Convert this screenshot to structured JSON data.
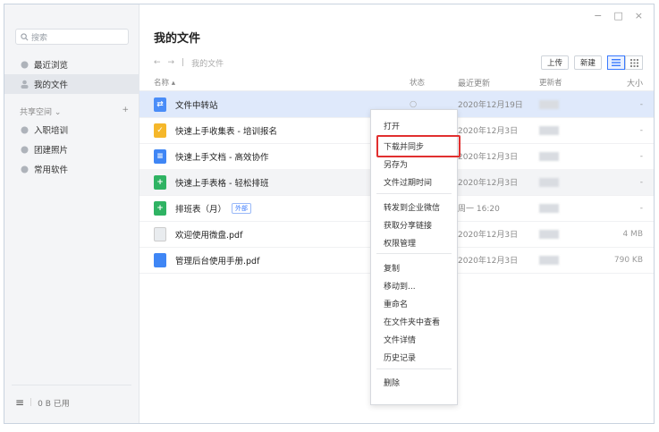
{
  "sidebar": {
    "search_placeholder": "搜索",
    "nav": [
      {
        "label": "最近浏览",
        "icon": "clock-icon"
      },
      {
        "label": "我的文件",
        "icon": "user-icon"
      }
    ],
    "section_title": "共享空间 ⌄",
    "section_add": "+",
    "spaces": [
      {
        "label": "入职培训",
        "icon": "space-icon"
      },
      {
        "label": "团建照片",
        "icon": "space-icon"
      },
      {
        "label": "常用软件",
        "icon": "space-icon"
      }
    ],
    "menu_icon": "≡",
    "storage": "0 B 已用"
  },
  "window": {
    "minimize": "−",
    "maximize": "□",
    "close": "×"
  },
  "main": {
    "title": "我的文件",
    "back": "←",
    "forward": "→",
    "separator": "|",
    "breadcrumb": "我的文件",
    "upload": "上传",
    "new": "新建",
    "columns": {
      "name": "名称 ▴",
      "state": "状态",
      "date": "最近更新",
      "updater": "更新者",
      "size": "大小"
    }
  },
  "files": [
    {
      "name": "文件中转站",
      "icon": "folder-icon",
      "color": "#4a8df8",
      "state": "○",
      "date": "2020年12月19日",
      "size": "-",
      "tag": ""
    },
    {
      "name": "快速上手收集表 - 培训报名",
      "icon": "form-icon",
      "color": "#f5b72a",
      "state": "",
      "date": "2020年12月3日",
      "size": "-",
      "tag": ""
    },
    {
      "name": "快速上手文档 - 高效协作",
      "icon": "doc-icon",
      "color": "#3f86f5",
      "state": "",
      "date": "2020年12月3日",
      "size": "-",
      "tag": ""
    },
    {
      "name": "快速上手表格 - 轻松排班",
      "icon": "sheet-icon",
      "color": "#2fb363",
      "state": "",
      "date": "2020年12月3日",
      "size": "-",
      "tag": ""
    },
    {
      "name": "排班表（月）",
      "icon": "sheet-icon",
      "color": "#2fb363",
      "state": "",
      "date": "周一 16:20",
      "size": "-",
      "tag": "外部"
    },
    {
      "name": "欢迎使用微盘.pdf",
      "icon": "pdf-icon",
      "color": "#e9ecef",
      "state": "",
      "date": "2020年12月3日",
      "size": "4 MB",
      "tag": ""
    },
    {
      "name": "管理后台使用手册.pdf",
      "icon": "pdf-icon",
      "color": "#3f86f5",
      "state": "",
      "date": "2020年12月3日",
      "size": "790 KB",
      "tag": ""
    }
  ],
  "context_menu": [
    "打开",
    "下载并同步",
    "另存为",
    "文件过期时间",
    "转发到企业微信",
    "获取分享链接",
    "权限管理",
    "复制",
    "移动到...",
    "重命名",
    "在文件夹中查看",
    "文件详情",
    "历史记录",
    "删除"
  ]
}
